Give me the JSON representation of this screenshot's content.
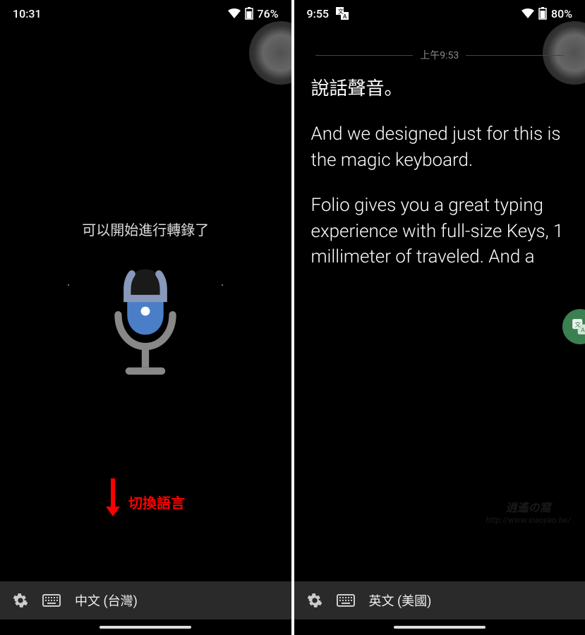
{
  "left": {
    "status": {
      "time": "10:31",
      "battery": "76%"
    },
    "prompt": "可以開始進行轉錄了",
    "annotation": "切換語言",
    "bottom": {
      "language": "中文 (台灣)"
    }
  },
  "right": {
    "status": {
      "time": "9:55",
      "battery": "80%"
    },
    "timestamp": "上午9:53",
    "transcript": {
      "p1": "說話聲音。",
      "p2": "And we designed just for this is the magic keyboard.",
      "p3": "Folio gives you a great typing experience with full-size Keys, 1 millimeter of traveled. And a"
    },
    "bottom": {
      "language": "英文 (美國)"
    }
  },
  "watermark": {
    "title": "逍遙の窩",
    "url": "http://www.xiaoyao.tw/"
  }
}
